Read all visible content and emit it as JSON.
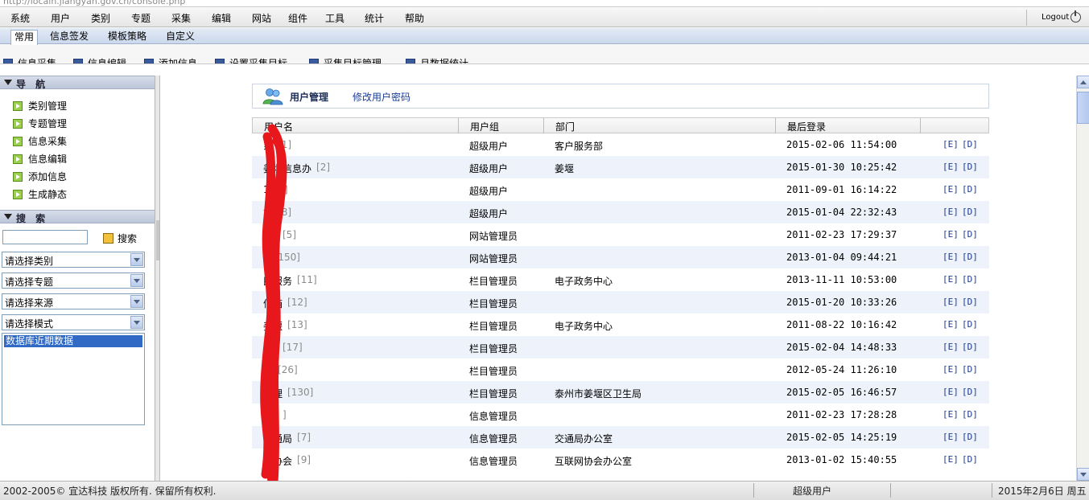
{
  "address_bar": {
    "url": "http://localh.jiangyan.gov.cn/console.php"
  },
  "menubar": {
    "items": [
      "系统",
      "用户",
      "类别",
      "专题",
      "采集",
      "编辑",
      "网站",
      "组件",
      "工具",
      "统计",
      "帮助"
    ],
    "logout_label": "Logout"
  },
  "tabs": [
    "常用",
    "信息签发",
    "模板策略",
    "自定义"
  ],
  "toolbar": [
    "信息采集",
    "信息编辑",
    "添加信息",
    "设置采集目标",
    "采集目标管理",
    "月数据统计"
  ],
  "sidebar": {
    "nav_title": "导 航",
    "nav_items": [
      "类别管理",
      "专题管理",
      "信息采集",
      "信息编辑",
      "添加信息",
      "生成静态"
    ],
    "search_title": "搜 索",
    "search_button": "搜索",
    "selects": [
      "请选择类别",
      "请选择专题",
      "请选择来源",
      "请选择模式"
    ],
    "list_option": "数据库近期数据"
  },
  "main": {
    "title": "用户管理",
    "change_password_link": "修改用户密码",
    "columns": [
      "用户名",
      "用户组",
      "部门",
      "最后登录"
    ],
    "rows": [
      {
        "name": "系",
        "uid": "[1]",
        "group": "超级用户",
        "dept": "客户服务部",
        "last": "2015-02-06 11:54:00",
        "e": "[E]",
        "d": "[D]"
      },
      {
        "name": "姜堰信息办",
        "uid": "[2]",
        "group": "超级用户",
        "dept": "姜堰",
        "last": "2015-01-30 10:25:42",
        "e": "[E]",
        "d": "[D]"
      },
      {
        "name": "1",
        "uid": "[6]",
        "group": "超级用户",
        "dept": "",
        "last": "2011-09-01 16:14:22",
        "e": "[E]",
        "d": "[D]"
      },
      {
        "name": "高",
        "uid": "[8]",
        "group": "超级用户",
        "dept": "",
        "last": "2015-01-04 22:32:43",
        "e": "[E]",
        "d": "[D]"
      },
      {
        "name": "",
        "uid": "[5]",
        "group": "网站管理员",
        "dept": "",
        "last": "2011-02-23 17:29:37",
        "e": "[E]",
        "d": "[D]"
      },
      {
        "name": "1",
        "uid": "[150]",
        "group": "网站管理员",
        "dept": "",
        "last": "2013-01-04 09:44:21",
        "e": "[E]",
        "d": "[D]"
      },
      {
        "name": "民服务",
        "uid": "[11]",
        "group": "栏目管理员",
        "dept": "电子政务中心",
        "last": "2013-11-11 10:53:00",
        "e": "[E]",
        "d": "[D]"
      },
      {
        "name": "信箱",
        "uid": "[12]",
        "group": "栏目管理员",
        "dept": "",
        "last": "2015-01-20 10:33:26",
        "e": "[E]",
        "d": "[D]"
      },
      {
        "name": "姜堰",
        "uid": "[13]",
        "group": "栏目管理员",
        "dept": "电子政务中心",
        "last": "2011-08-22 10:16:42",
        "e": "[E]",
        "d": "[D]"
      },
      {
        "name": "",
        "uid": "[17]",
        "group": "栏目管理员",
        "dept": "",
        "last": "2015-02-04 14:48:33",
        "e": "[E]",
        "d": "[D]"
      },
      {
        "name": "员",
        "uid": "[26]",
        "group": "栏目管理员",
        "dept": "",
        "last": "2012-05-24 11:26:10",
        "e": "[E]",
        "d": "[D]"
      },
      {
        "name": "管理",
        "uid": "[130]",
        "group": "栏目管理员",
        "dept": "泰州市姜堰区卫生局",
        "last": "2015-02-05 16:46:57",
        "e": "[E]",
        "d": "[D]"
      },
      {
        "name": "",
        "uid": "]",
        "group": "信息管理员",
        "dept": "",
        "last": "2011-02-23 17:28:28",
        "e": "[E]",
        "d": "[D]"
      },
      {
        "name": "交通局",
        "uid": "[7]",
        "group": "信息管理员",
        "dept": "交通局办公室",
        "last": "2015-02-05 14:25:19",
        "e": "[E]",
        "d": "[D]"
      },
      {
        "name": "网协会",
        "uid": "[9]",
        "group": "信息管理员",
        "dept": "互联网协会办公室",
        "last": "2013-01-02 15:40:55",
        "e": "[E]",
        "d": "[D]"
      }
    ]
  },
  "statusbar": {
    "copyright": "2002-2005© 宜达科技 版权所有. 保留所有权利.",
    "role": "超级用户",
    "date": "2015年2月6日 周五"
  },
  "colors": {
    "accent": "#316ac5",
    "scribble": "#e8171b"
  }
}
